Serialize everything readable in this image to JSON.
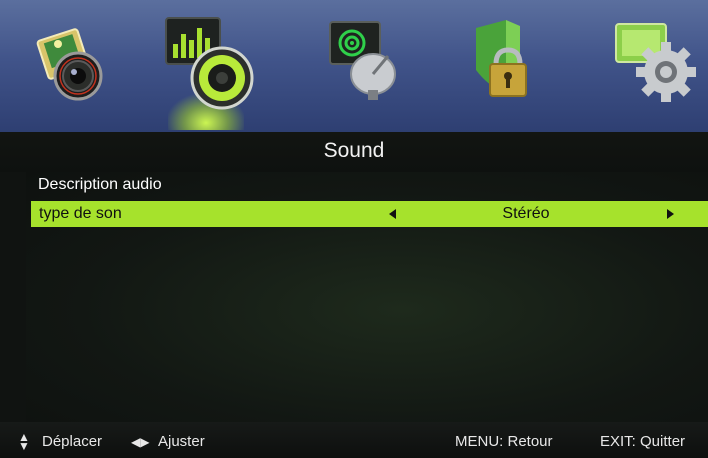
{
  "top_menu": {
    "items": [
      {
        "icon": "picture-camera-icon",
        "selected": false
      },
      {
        "icon": "sound-speaker-icon",
        "selected": true
      },
      {
        "icon": "satellite-dish-icon",
        "selected": false
      },
      {
        "icon": "lock-shield-icon",
        "selected": false
      },
      {
        "icon": "settings-gear-icon",
        "selected": false
      }
    ],
    "highlight_color": "#b8f02e"
  },
  "page": {
    "title": "Sound"
  },
  "content": {
    "section_label": "Description audio",
    "rows": [
      {
        "label": "type de son",
        "value": "Stéréo",
        "selected": true
      }
    ],
    "row_highlight_color": "#a6e22c"
  },
  "footer": {
    "move_hint": "Déplacer",
    "adjust_hint": "Ajuster",
    "menu_hint": "MENU: Retour",
    "exit_hint": "EXIT: Quitter"
  }
}
